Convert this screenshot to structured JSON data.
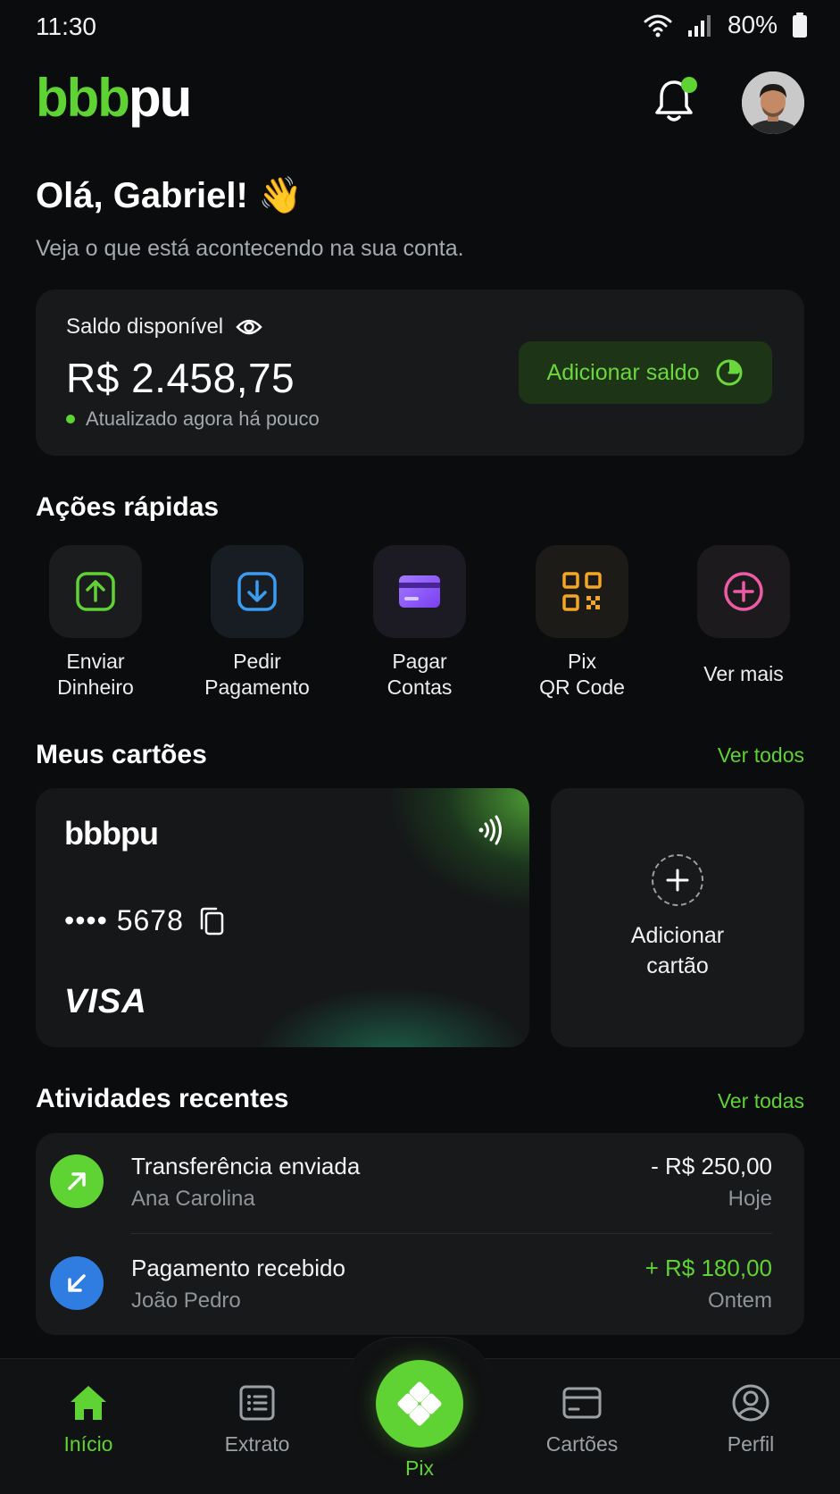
{
  "status_bar": {
    "time": "11:30",
    "battery": "80%"
  },
  "header": {
    "logo_green": "bbb",
    "logo_white": "pu"
  },
  "greeting": {
    "title": "Olá, Gabriel! 👋",
    "subtitle": "Veja o que está acontecendo na sua conta."
  },
  "balance": {
    "label": "Saldo disponível",
    "value": "R$ 2.458,75",
    "updated": "Atualizado agora há pouco",
    "add_button": "Adicionar saldo"
  },
  "quick_actions": {
    "title": "Ações rápidas",
    "items": [
      {
        "line1": "Enviar",
        "line2": "Dinheiro",
        "icon": "upload-icon",
        "color": "#5fd234"
      },
      {
        "line1": "Pedir",
        "line2": "Pagamento",
        "icon": "download-icon",
        "color": "#3b9cf0"
      },
      {
        "line1": "Pagar",
        "line2": "Contas",
        "icon": "credit-card-icon",
        "color": "#8b5cf6"
      },
      {
        "line1": "Pix",
        "line2": "QR Code",
        "icon": "qr-code-icon",
        "color": "#f5a623"
      },
      {
        "line1": "Ver mais",
        "line2": "",
        "icon": "plus-circle-icon",
        "color": "#ec5ca5"
      }
    ]
  },
  "cards": {
    "title": "Meus cartões",
    "link": "Ver todos",
    "card": {
      "logo": "bbbpu",
      "number": "•••• 5678",
      "brand": "VISA"
    },
    "add_card": {
      "line1": "Adicionar",
      "line2": "cartão"
    }
  },
  "activities": {
    "title": "Atividades recentes",
    "link": "Ver todas",
    "items": [
      {
        "title": "Transferência enviada",
        "name": "Ana Carolina",
        "amount": "- R$ 250,00",
        "date": "Hoje",
        "icon": "arrow-up-right-icon",
        "color": "#5fd234"
      },
      {
        "title": "Pagamento recebido",
        "name": "João Pedro",
        "amount": "+ R$ 180,00",
        "date": "Ontem",
        "icon": "arrow-down-left-icon",
        "color": "#2f7de1"
      }
    ]
  },
  "nav": {
    "items": [
      {
        "label": "Início",
        "icon": "home-icon",
        "active": true
      },
      {
        "label": "Extrato",
        "icon": "list-icon",
        "active": false
      },
      {
        "label": "Pix",
        "icon": "pix-icon",
        "active": false
      },
      {
        "label": "Cartões",
        "icon": "card-icon",
        "active": false
      },
      {
        "label": "Perfil",
        "icon": "user-icon",
        "active": false
      }
    ]
  },
  "colors": {
    "accent": "#5fd234",
    "background": "#0b0c0d",
    "surface": "#17191b"
  }
}
